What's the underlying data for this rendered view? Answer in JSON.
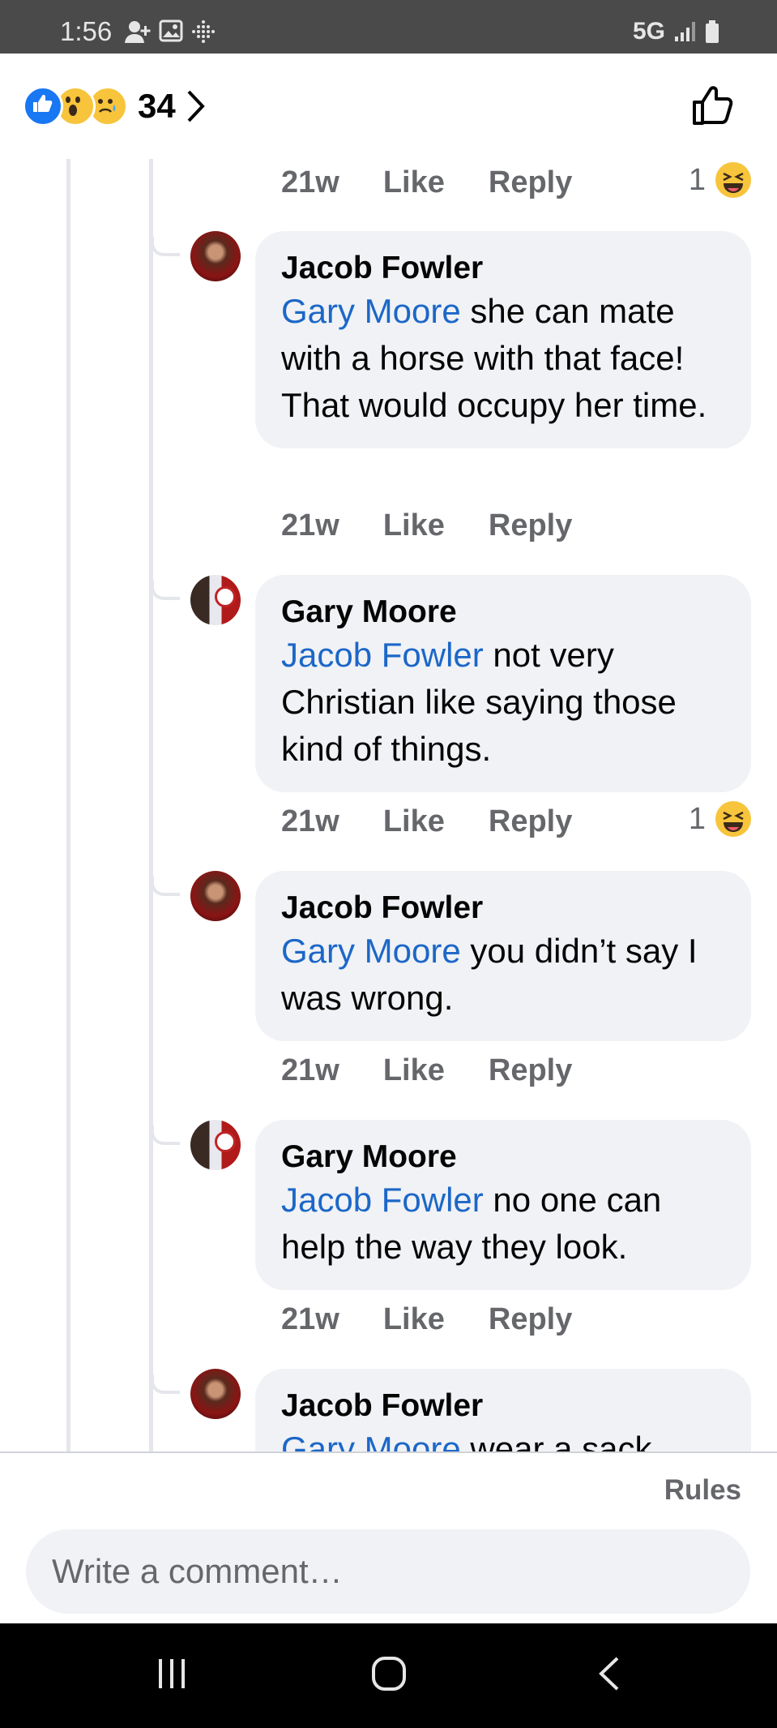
{
  "status_bar": {
    "time": "1:56",
    "network": "5G"
  },
  "reactions": {
    "count": "34",
    "icons": [
      "like-reaction-icon",
      "wow-reaction-icon",
      "sad-reaction-icon"
    ]
  },
  "comments": [
    {
      "time": "21w",
      "like_label": "Like",
      "reply_label": "Reply",
      "reaction_count": "1",
      "reaction_icon": "haha-reaction-icon"
    },
    {
      "author": "Jacob Fowler",
      "mention": "Gary Moore",
      "text": " she can mate with a horse with that face! That would occupy her time.",
      "time": "21w",
      "like_label": "Like",
      "reply_label": "Reply"
    },
    {
      "author": "Gary Moore",
      "mention": "Jacob Fowler",
      "text": " not very Christian like saying those kind of things.",
      "time": "21w",
      "like_label": "Like",
      "reply_label": "Reply",
      "reaction_count": "1",
      "reaction_icon": "haha-reaction-icon"
    },
    {
      "author": "Jacob Fowler",
      "mention": "Gary Moore",
      "text": " you didn’t say I was wrong.",
      "time": "21w",
      "like_label": "Like",
      "reply_label": "Reply"
    },
    {
      "author": "Gary Moore",
      "mention": "Jacob Fowler",
      "text": " no one can help the way they look.",
      "time": "21w",
      "like_label": "Like",
      "reply_label": "Reply"
    },
    {
      "author": "Jacob Fowler",
      "mention": "Gary Moore",
      "text": " wear a sack"
    }
  ],
  "footer": {
    "rules_label": "Rules",
    "comment_placeholder": "Write a comment…"
  },
  "colors": {
    "mention": "#1c67c8",
    "like_blue": "#1877f2",
    "bubble": "#f0f2f5",
    "meta_grey": "#65676b"
  }
}
